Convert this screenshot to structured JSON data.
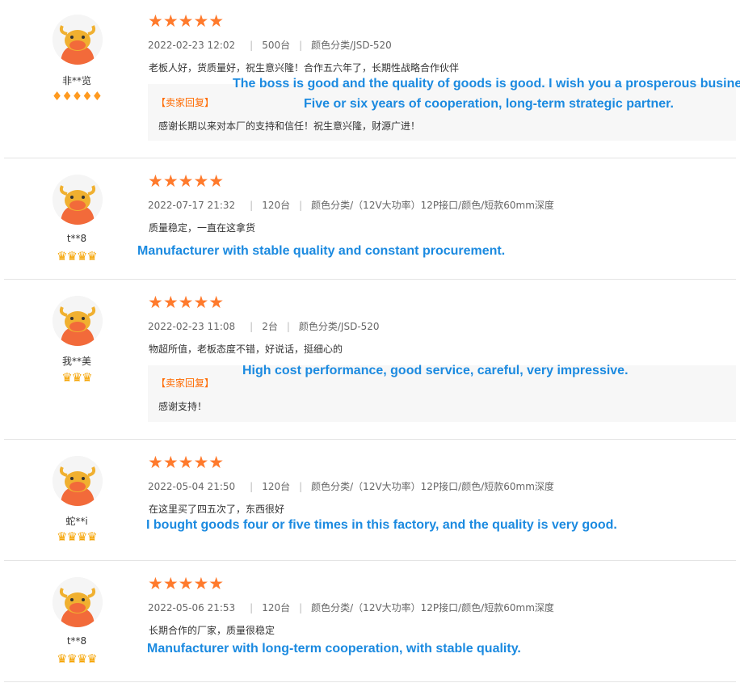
{
  "reviews": [
    {
      "username": "非**览",
      "badge": "♦♦♦♦♦",
      "stars": "★★★★★",
      "date": "2022-02-23 12:02",
      "quantity": "500台",
      "spec": "颜色分类/JSD-520",
      "content": "老板人好，货质量好，祝生意兴隆！合作五六年了，长期性战略合作伙伴",
      "translation_1": "The boss is good and the quality of goods is good. I wish you a prosperous business!",
      "translation_2": "Five or six years of cooperation, long-term strategic partner.",
      "reply_title": "【卖家回复】",
      "reply_text": "感谢长期以来对本厂的支持和信任！祝生意兴隆，财源广进！"
    },
    {
      "username": "t**8",
      "badge": "♛♛♛♛",
      "stars": "★★★★★",
      "date": "2022-07-17 21:32",
      "quantity": "120台",
      "spec": "颜色分类/（12V大功率）12P接口/颜色/短款60mm深度",
      "content": "质量稳定，一直在这拿货",
      "translation_1": "Manufacturer with stable quality and constant procurement."
    },
    {
      "username": "我**美",
      "badge": "♛♛♛",
      "stars": "★★★★★",
      "date": "2022-02-23 11:08",
      "quantity": "2台",
      "spec": "颜色分类/JSD-520",
      "content": "物超所值，老板态度不错，好说话，挺细心的",
      "translation_1": "High cost performance, good service, careful, very impressive.",
      "reply_title": "【卖家回复】",
      "reply_text": "感谢支持！"
    },
    {
      "username": "蛇**i",
      "badge": "♛♛♛♛",
      "stars": "★★★★★",
      "date": "2022-05-04 21:50",
      "quantity": "120台",
      "spec": "颜色分类/（12V大功率）12P接口/颜色/短款60mm深度",
      "content": "在这里买了四五次了，东西很好",
      "translation_1": "I bought goods four or five times in this factory, and the quality is very good."
    },
    {
      "username": "t**8",
      "badge": "♛♛♛♛",
      "stars": "★★★★★",
      "date": "2022-05-06 21:53",
      "quantity": "120台",
      "spec": "颜色分类/（12V大功率）12P接口/颜色/短款60mm深度",
      "content": "长期合作的厂家，质量很稳定",
      "translation_1": "Manufacturer with long-term cooperation, with stable quality."
    }
  ],
  "colors": {
    "star": "#ff7a2c",
    "translation": "#1b8ae0",
    "reply_title": "#ff6a00",
    "avatar_face": "#f26a3a"
  }
}
